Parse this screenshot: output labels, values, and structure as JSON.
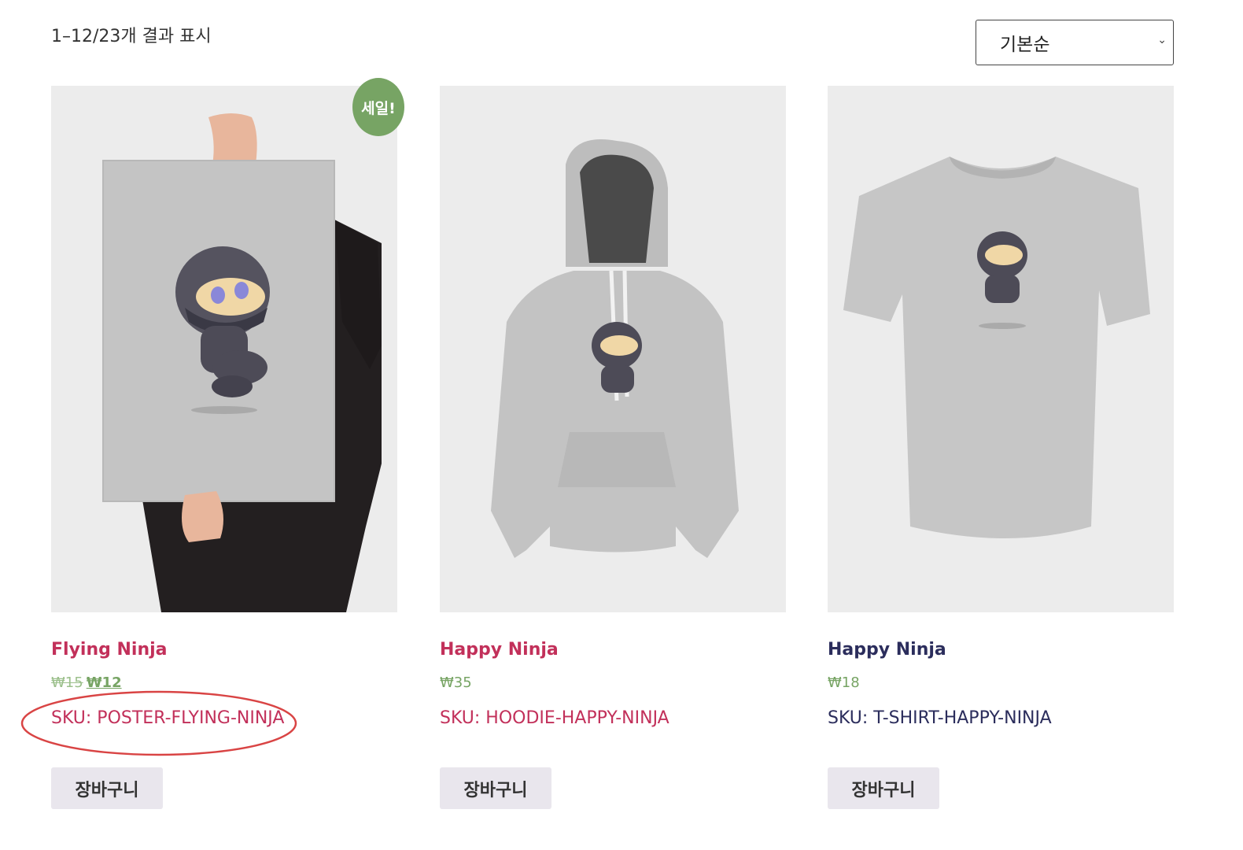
{
  "result_count": "1–12/23개 결과 표시",
  "sort": {
    "selected": "기본순"
  },
  "sale_badge": "세일!",
  "products": [
    {
      "title": "Flying Ninja",
      "regular_price": "₩15",
      "sale_price": "₩12",
      "sku": "SKU: POSTER-FLYING-NINJA",
      "button": "장바구니"
    },
    {
      "title": "Happy Ninja",
      "price": "₩35",
      "sku": "SKU: HOODIE-HAPPY-NINJA",
      "button": "장바구니"
    },
    {
      "title": "Happy Ninja",
      "price": "₩18",
      "sku": "SKU: T-SHIRT-HAPPY-NINJA",
      "button": "장바구니"
    }
  ],
  "colors": {
    "link": "#c2305a",
    "link_visited": "#2b2d5c",
    "price": "#77a464",
    "sale_badge": "#77a464",
    "button_bg": "#e9e6ed",
    "annotation": "#d94444"
  }
}
